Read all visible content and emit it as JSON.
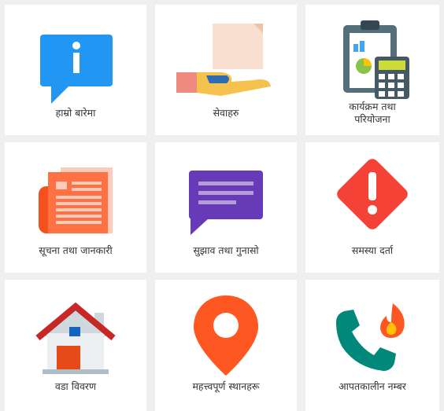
{
  "tiles": [
    {
      "label": "हाम्रो बारेमा",
      "icon": "info-icon"
    },
    {
      "label": "सेवाहरु",
      "icon": "service-hand-icon"
    },
    {
      "label_line1": "कार्यक्रम तथा",
      "label_line2": "परियोजना",
      "icon": "clipboard-calculator-icon"
    },
    {
      "label": "सूचना तथा जानकारी",
      "icon": "newspaper-icon"
    },
    {
      "label": "सुझाव तथा गुनासो",
      "icon": "chat-message-icon"
    },
    {
      "label": "समस्या दर्ता",
      "icon": "warning-icon"
    },
    {
      "label": "वडा विवरण",
      "icon": "house-icon"
    },
    {
      "label": "महत्त्वपूर्ण स्थानहरू",
      "icon": "location-pin-icon"
    },
    {
      "label": "आपतकालीन नम्बर",
      "icon": "emergency-phone-icon"
    }
  ],
  "colors": {
    "info": "#2196f3",
    "chat": "#673ab7",
    "warning": "#f44336",
    "pin": "#ff5722",
    "phone": "#00897b",
    "newspaper": "#ff7043"
  }
}
